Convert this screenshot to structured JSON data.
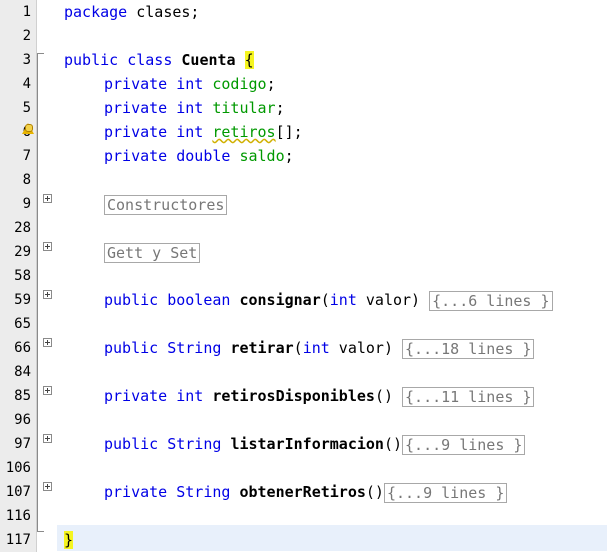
{
  "line_numbers": [
    "1",
    "2",
    "3",
    "4",
    "5",
    "6",
    "7",
    "8",
    "9",
    "28",
    "29",
    "58",
    "59",
    "65",
    "66",
    "84",
    "85",
    "96",
    "97",
    "106",
    "107",
    "116",
    "117"
  ],
  "code": {
    "l1_package": "package",
    "l1_name": " clases;",
    "l3_public": "public",
    "l3_class": " class ",
    "l3_name": "Cuenta",
    "l3_brace": "{",
    "l4_private": "private",
    "l4_type": " int ",
    "l4_field": "codigo",
    "l4_semi": ";",
    "l5_private": "private",
    "l5_type": " int ",
    "l5_field": "titular",
    "l5_semi": ";",
    "l6_private": "private",
    "l6_type": " int ",
    "l6_field": "retiros",
    "l6_semi": "[];",
    "l7_private": "private",
    "l7_type": " double ",
    "l7_field": "saldo",
    "l7_semi": ";",
    "fold_constructores": "Constructores",
    "fold_gettset": "Gett y Set",
    "m59_mod": "public",
    "m59_type": " boolean ",
    "m59_name": "consignar",
    "m59_paren": "(",
    "m59_ptype": "int",
    "m59_params": " valor) ",
    "m59_fold": "{...6 lines }",
    "m66_mod": "public",
    "m66_type": " String ",
    "m66_name": "retirar",
    "m66_paren": "(",
    "m66_ptype": "int",
    "m66_params": " valor) ",
    "m66_fold": "{...18 lines }",
    "m85_mod": "private",
    "m85_type": " int ",
    "m85_name": "retirosDisponibles",
    "m85_params": "() ",
    "m85_fold": "{...11 lines }",
    "m97_mod": "public",
    "m97_type": " String ",
    "m97_name": "listarInformacion",
    "m97_params": "()",
    "m97_fold": "{...9 lines }",
    "m107_mod": "private",
    "m107_type": " String ",
    "m107_name": "obtenerRetiros",
    "m107_params": "()",
    "m107_fold": "{...9 lines }",
    "l117_brace": "}"
  },
  "colors": {
    "keyword": "#0000e6",
    "field": "#009900",
    "brace_highlight": "#f5f520",
    "current_line": "#e8f0fb"
  },
  "icons": [
    "warning-icon",
    "fold-expand-icon"
  ]
}
